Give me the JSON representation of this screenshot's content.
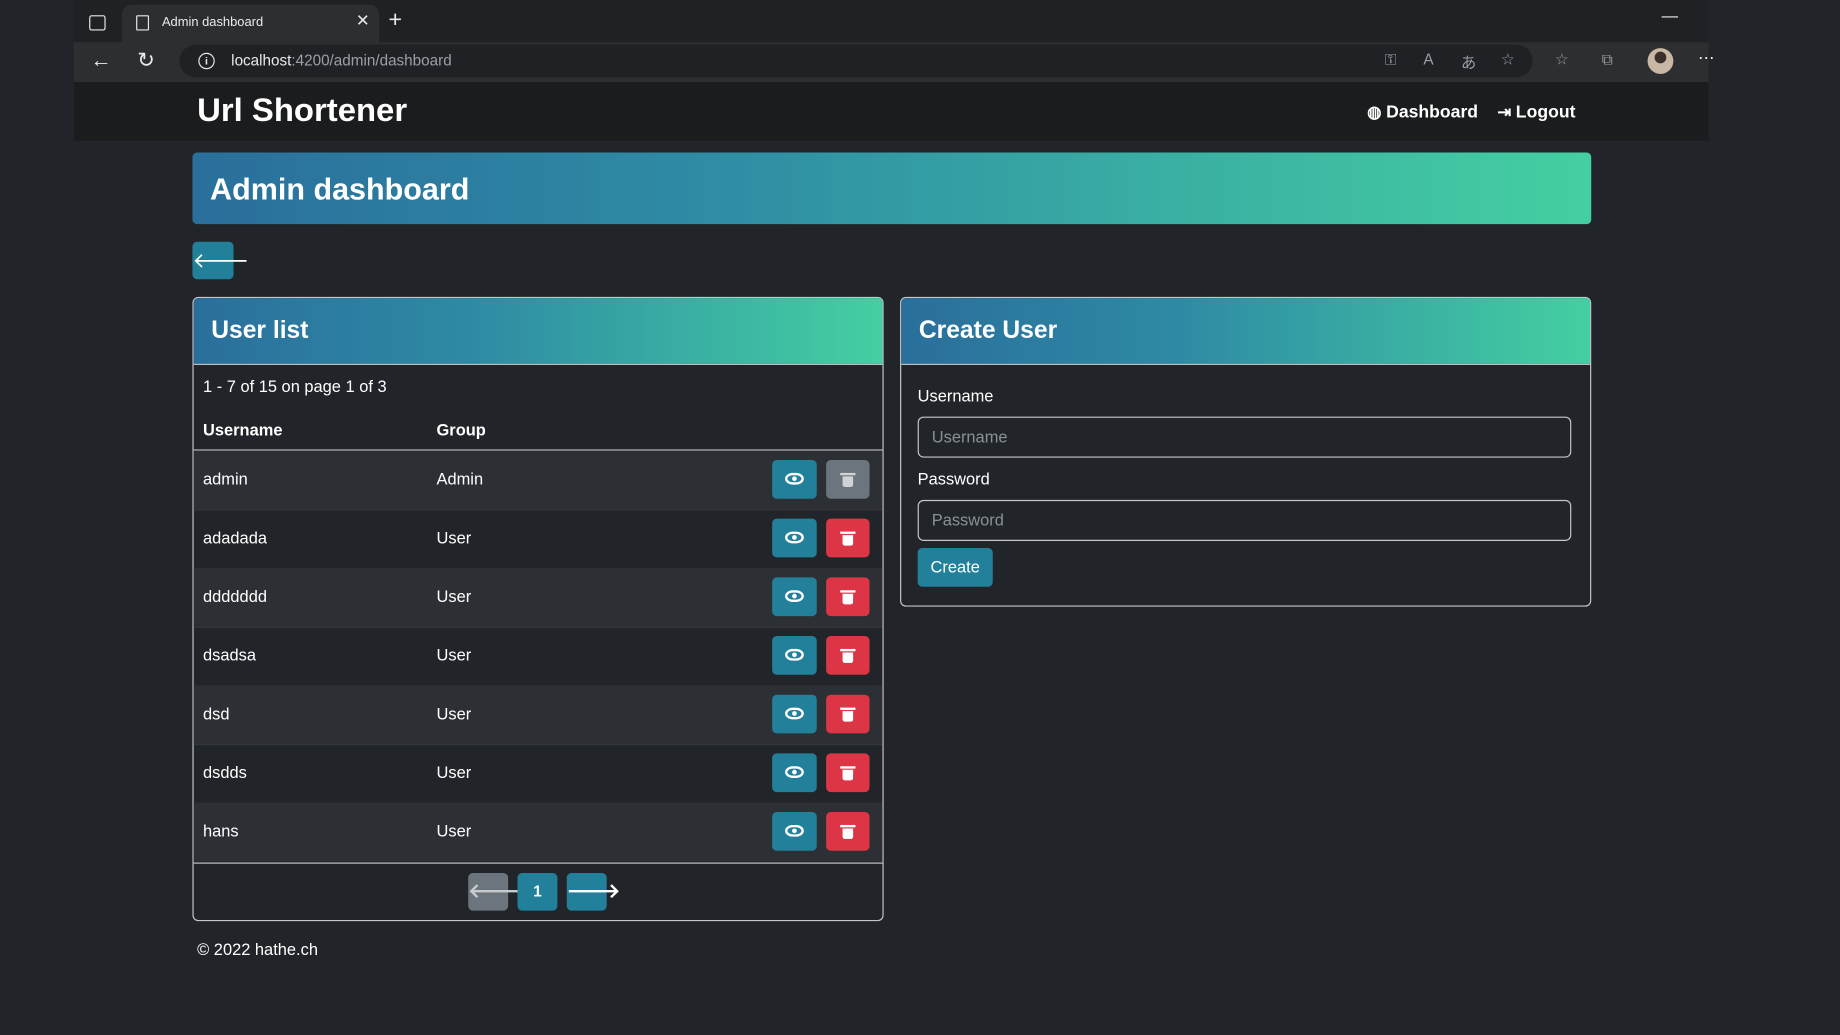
{
  "browser": {
    "tab_title": "Admin dashboard",
    "tab_close": "✕",
    "new_tab": "+",
    "minimize": "—",
    "url_host": "localhost",
    "url_path": ":4200/admin/dashboard",
    "more": "⋯"
  },
  "navbar": {
    "brand": "Url Shortener",
    "dashboard_label": "Dashboard",
    "logout_label": "Logout"
  },
  "hero": {
    "title": "Admin dashboard"
  },
  "back_button": {
    "icon": "arrow-left-icon",
    "glyph": "🡐"
  },
  "user_list": {
    "title": "User list",
    "summary": "1 - 7 of 15 on page 1 of 3",
    "columns": [
      "Username",
      "Group"
    ],
    "rows": [
      {
        "username": "admin",
        "group": "Admin",
        "delete_disabled": true
      },
      {
        "username": "adadada",
        "group": "User",
        "delete_disabled": false
      },
      {
        "username": "ddddddd",
        "group": "User",
        "delete_disabled": false
      },
      {
        "username": "dsadsa",
        "group": "User",
        "delete_disabled": false
      },
      {
        "username": "dsd",
        "group": "User",
        "delete_disabled": false
      },
      {
        "username": "dsdds",
        "group": "User",
        "delete_disabled": false
      },
      {
        "username": "hans",
        "group": "User",
        "delete_disabled": false
      }
    ],
    "pagination": {
      "prev": "🡐",
      "current": "1",
      "next": "🡒"
    }
  },
  "create_user": {
    "title": "Create User",
    "username_label": "Username",
    "username_placeholder": "Username",
    "password_label": "Password",
    "password_placeholder": "Password",
    "submit_label": "Create"
  },
  "footer": {
    "text": "© 2022 hathe.ch"
  },
  "colors": {
    "background": "#212529",
    "accent": "#23809a",
    "danger": "#dc3545",
    "disabled": "#6c757d",
    "gradient_start": "#2a6f9c",
    "gradient_end": "#44cfa2"
  }
}
